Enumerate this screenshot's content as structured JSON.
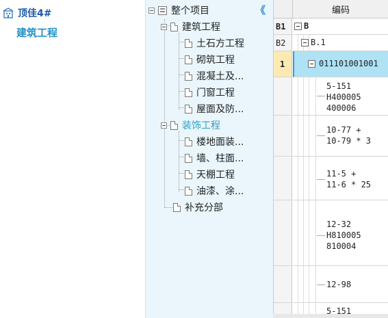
{
  "project": {
    "name": "顶佳4#",
    "type_label": "建筑工程",
    "icon": "building-icon"
  },
  "tree": {
    "collapse_glyph": "《",
    "root": "整个项目",
    "groups": [
      {
        "label": "建筑工程",
        "items": [
          "土石方工程",
          "砌筑工程",
          "混凝土及...",
          "门窗工程",
          "屋面及防..."
        ]
      },
      {
        "label": "装饰工程",
        "items": [
          "楼地面装...",
          "墙、柱面...",
          "天棚工程",
          "油漆、涂..."
        ]
      }
    ],
    "extra": "补充分部"
  },
  "grid": {
    "column_header": "编码",
    "rows": [
      {
        "index": "B1",
        "code": "B"
      },
      {
        "index": "B2",
        "code": "B.1"
      },
      {
        "index": "1",
        "code": "011101001001"
      }
    ],
    "sub_entries": [
      "5-151\nH400005\n400006",
      "10-77 +\n10-79 * 3",
      "11-5 +\n11-6 * 25",
      "12-32\nH810005\n810004",
      "12-98",
      "5-151"
    ],
    "colors": {
      "selected_row_bg": "#aee2f4",
      "selected_index_bg": "#fde9b4"
    }
  }
}
